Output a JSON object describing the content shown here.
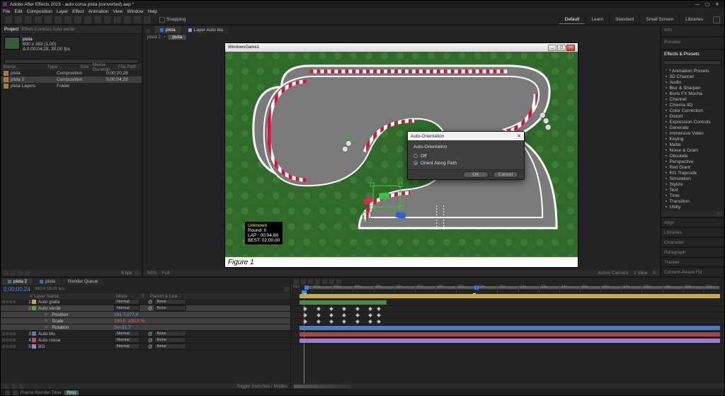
{
  "title_bar": "Adobe After Effects 2023 - auto corsa pista (converted).aep *",
  "menus": [
    "File",
    "Edit",
    "Composition",
    "Layer",
    "Effect",
    "Animation",
    "View",
    "Window",
    "Help"
  ],
  "snapping": "Snapping",
  "workspaces": [
    "Default",
    "Learn",
    "Standard",
    "Small Screen",
    "Libraries"
  ],
  "workspace_active": "Default",
  "project": {
    "tab": "Project",
    "effects_tab": "Effect Controls Auto verde",
    "item": {
      "name": "pista",
      "dims": "600 x 383 (1,00)",
      "dur": "Δ 0;00;04;28, 30,00 fps"
    },
    "columns": [
      "Name",
      "",
      "Type",
      "Size",
      "Media Duration",
      "File Path"
    ],
    "rows": [
      {
        "name": "pista",
        "type": "Composition",
        "dur": "0;00;20;28"
      },
      {
        "name": "pista 2",
        "type": "Composition",
        "dur": "0;00;04;28"
      },
      {
        "name": "pista Layers",
        "type": "Folder",
        "dur": ""
      }
    ]
  },
  "composition": {
    "tabs": [
      {
        "label": "pista",
        "active": true
      },
      {
        "label": "Layer Auto blu",
        "active": false
      }
    ],
    "flow": [
      "pista 2",
      "‹",
      "pista"
    ],
    "window_title": "WindowsGame1",
    "lap": {
      "l0": "Unknown",
      "l1": "Round:  0",
      "l2": "LAP :  00:04,68",
      "l3": "BEST:  02:00,00"
    },
    "figure": "Figure 1"
  },
  "modal": {
    "title": "Auto-Orientation",
    "group": "Auto-Orientation",
    "opt_off": "Off",
    "opt_path": "Orient Along Path",
    "ok": "OK",
    "cancel": "Cancel"
  },
  "right_tabs": [
    "Info",
    "Preview",
    "Effects & Presets"
  ],
  "effects_placeholder": "",
  "effects": [
    "* Animation Presets",
    "3D Channel",
    "Audio",
    "Blur & Sharpen",
    "Boris FX Mocha",
    "Channel",
    "Cinema 4D",
    "Color Correction",
    "Distort",
    "Expression Controls",
    "Generate",
    "Immersive Video",
    "Keying",
    "Matte",
    "Noise & Grain",
    "Obsolete",
    "Perspective",
    "Red Giant",
    "RG Trapcode",
    "Simulation",
    "Stylize",
    "Text",
    "Time",
    "Transition",
    "Utility"
  ],
  "right_lower": [
    "Align",
    "Libraries",
    "Character",
    "Paragraph",
    "Tracker",
    "Content-Aware Fill"
  ],
  "viewer_status": {
    "zoom": "50%",
    "mode": "Full",
    "view": "Active Camera",
    "nview": "1 View",
    "exp": "0"
  },
  "timeline": {
    "tabs": [
      "pista 2",
      "pista"
    ],
    "active_tab": "pista 2",
    "rq": "Render Queue",
    "current_time": "0;00;00;24",
    "frame_info": "00024 (30.00 fps)",
    "columns": {
      "num": "#",
      "name": "Layer Name",
      "mode": "Mode",
      "trk": "T",
      "parent": "Parent & Link"
    },
    "none": "None",
    "normal": "Normal",
    "pick": "@",
    "layers": [
      {
        "n": "1",
        "name": "Auto gialla",
        "color": "#caa93e",
        "mode": true,
        "par": true
      },
      {
        "n": "2",
        "name": "Auto verde",
        "color": "#54a154",
        "mode": true,
        "par": true,
        "sel": true,
        "props": [
          {
            "name": "Position",
            "val": "291,7,277,6"
          },
          {
            "name": "Scale",
            "val": "100,0 ,100,0 %",
            "red": true
          },
          {
            "name": "Rotation",
            "val": "0x+33,7°"
          }
        ]
      },
      {
        "n": "3",
        "name": "Auto blu",
        "color": "#4e7bbf",
        "mode": true,
        "par": true
      },
      {
        "n": "4",
        "name": "Auto rossa",
        "color": "#c05050",
        "mode": true,
        "par": true
      },
      {
        "n": "5",
        "name": "BG",
        "color": "#9a7fd1",
        "mode": true,
        "par": true
      }
    ],
    "ruler": [
      "01s",
      "02s",
      "03s",
      "04s",
      "05s",
      "06s",
      "07s",
      "08s",
      "09s",
      "10s",
      "11s",
      "12s",
      "13s",
      "14s",
      "15s",
      "16s",
      "17s",
      "18s",
      "19s",
      "20s",
      "21s"
    ],
    "toggle": "Toggle Switches / Modes"
  },
  "footer": {
    "frt": "Frame Render Time",
    "pill": "0ms"
  }
}
